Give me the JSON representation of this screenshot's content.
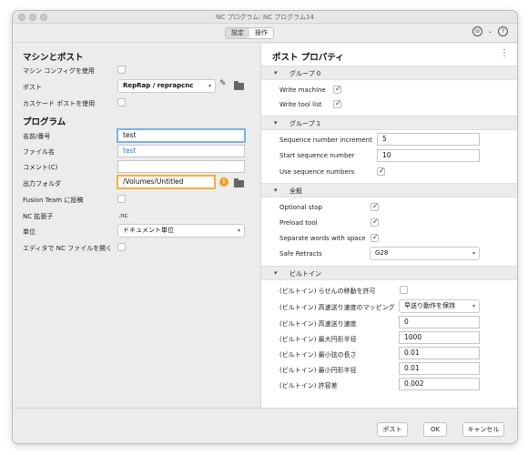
{
  "window": {
    "title": "NC プログラム: NC プログラム14"
  },
  "tabs": [
    {
      "label": "設定"
    },
    {
      "label": "操作"
    }
  ],
  "left": {
    "machine_post_heading": "マシンとポスト",
    "use_machine_config_label": "マシン コンフィグを使用",
    "post_label": "ポスト",
    "post_value": "RepRap / reprapcnc",
    "use_cascade_post_label": "カスケード ポストを使用",
    "program_heading": "プログラム",
    "name_number_label": "名前/番号",
    "name_number_value": "test",
    "filename_label": "ファイル名",
    "filename_value": "test",
    "comment_label": "コメント(C)",
    "comment_value": "",
    "output_folder_label": "出力フォルダ",
    "output_folder_value": "/Volumes/Untitled",
    "fusion_team_label": "Fusion Team に投稿",
    "nc_ext_label": "NC 拡張子",
    "nc_ext_value": ".nc",
    "unit_label": "単位",
    "unit_value": "ドキュメント単位",
    "open_in_editor_label": "エディタで NC ファイルを開く"
  },
  "right": {
    "heading": "ポスト プロパティ",
    "groups": [
      {
        "title": "グループ 0"
      },
      {
        "title": "グループ 1"
      },
      {
        "title": "全般"
      },
      {
        "title": "ビルトイン"
      }
    ],
    "write_machine_label": "Write machine",
    "write_machine_checked": true,
    "write_tool_list_label": "Write tool list",
    "write_tool_list_checked": true,
    "seq_inc_label": "Sequence number increment",
    "seq_inc_value": "5",
    "seq_start_label": "Start sequence number",
    "seq_start_value": "10",
    "use_seq_label": "Use sequence numbers",
    "use_seq_checked": true,
    "optional_stop_label": "Optional stop",
    "optional_stop_checked": true,
    "preload_tool_label": "Preload tool",
    "preload_tool_checked": true,
    "separate_words_label": "Separate words with space",
    "separate_words_checked": true,
    "safe_retracts_label": "Safe Retracts",
    "safe_retracts_value": "G28",
    "spiral_label": "(ビルトイン) らせんの移動を許可",
    "spiral_checked": false,
    "rapid_map_label": "(ビルトイン) 高速送り速度のマッピング",
    "rapid_map_value": "早送り動作を保持",
    "rapid_feed_label": "(ビルトイン) 高速送り速度",
    "rapid_feed_value": "0",
    "max_circ_label": "(ビルトイン) 最大円形半径",
    "max_circ_value": "1000",
    "min_chord_label": "(ビルトイン) 最小弦の長さ",
    "min_chord_value": "0.01",
    "min_circ_label": "(ビルトイン) 最小円形半径",
    "min_circ_value": "0.01",
    "tolerance_label": "(ビルトイン) 許容差",
    "tolerance_value": "0.002"
  },
  "footer": {
    "post_label": "ポスト",
    "ok_label": "OK",
    "cancel_label": "キャンセル"
  },
  "icons": {
    "pencil": "pencil-icon",
    "folder": "folder-icon",
    "warning": "warning-icon",
    "help": "help-icon",
    "more": "kebab-icon"
  }
}
